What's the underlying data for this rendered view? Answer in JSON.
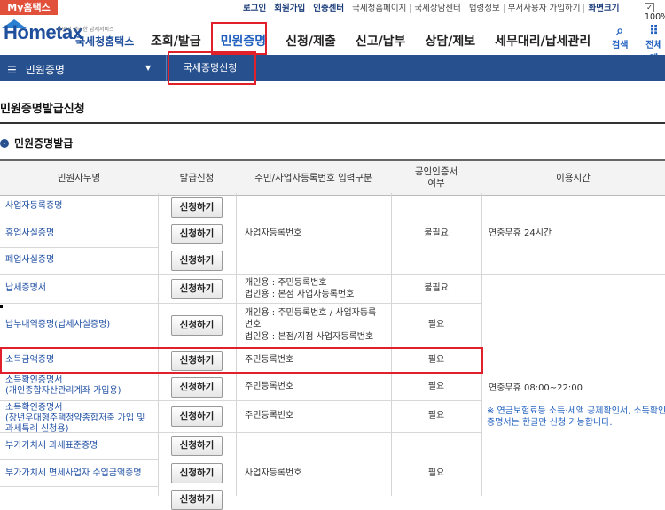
{
  "top": {
    "my_tab": "My홈택스",
    "util": [
      "로그인",
      "회원가입",
      "인증센터",
      "국세청홈페이지",
      "국세상담센터",
      "법령정보",
      "부서사용자 가입하기",
      "화면크기"
    ],
    "zoom": "100%"
  },
  "logo": {
    "main": "Hometax",
    "small": "국민이 편리한 납세서비스",
    "sub": "국세청홈택스"
  },
  "nav": [
    "조회/발급",
    "민원증명",
    "신청/제출",
    "신고/납부",
    "상담/제보",
    "세무대리/납세관리"
  ],
  "right": {
    "search": "검색",
    "all": "전체메"
  },
  "bar": {
    "menu": "민원증명",
    "crumb": "국세증명신청"
  },
  "page_title": "민원증명발급신청",
  "section_title": "민원증명발급",
  "table": {
    "headers": [
      "민원사무명",
      "발급신청",
      "주민/사업자등록번호 입력구분",
      "공인인증서\n여부",
      "이용시간"
    ],
    "button_label": "신청하기",
    "rows": [
      {
        "name": "사업자등록증명"
      },
      {
        "name": "휴업사실증명"
      },
      {
        "name": "폐업사실증명"
      },
      {
        "name": "납세증명서"
      },
      {
        "name": "납부내역증명(납세사실증명)"
      },
      {
        "name": "소득금액증명"
      },
      {
        "name": "소득확인증명서\n(개인종합자산관리계좌 가입용)"
      },
      {
        "name": "소득확인증명서\n(장년우대형주택청약종합저축 가입 및\n과세특례 신청용)"
      },
      {
        "name": "부가가치세 과세표준증명"
      },
      {
        "name": "부가가치세 면세사업자 수입금액증명"
      }
    ],
    "type_texts": {
      "biz": "사업자등록번호",
      "tax1": "개인용 : 주민등록번호",
      "tax2": "법인용 : 본점 사업자등록번호",
      "pay1": "개인용 : 주민등록번호 / 사업자등록",
      "pay2": "번호",
      "pay3": "법인용 : 본점/지점 사업자등록번호",
      "resident": "주민등록번호"
    },
    "cert": {
      "no": "불필요",
      "yes": "필요"
    },
    "hours": {
      "allday": "연중무휴 24시간",
      "limited": "연중무휴 08:00~22:00"
    },
    "note": "※ 연금보험료등 소득·세액 공제확인서, 소득확인증명서는 한글만 신청 가능합니다."
  }
}
